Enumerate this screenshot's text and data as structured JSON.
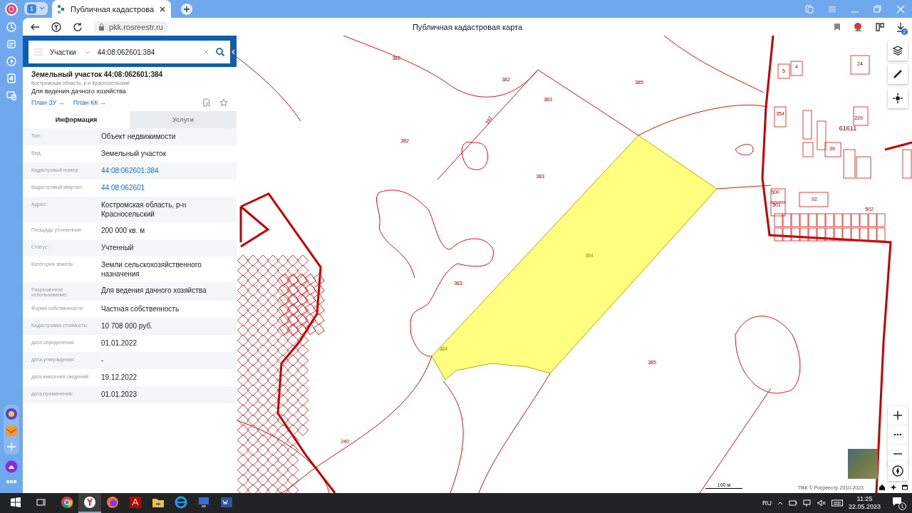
{
  "browser": {
    "profile_initial": "О",
    "tab_count": "1",
    "tabs": [
      {
        "title": "Публичная кадастрова",
        "selected": true
      }
    ],
    "url": "pkk.rosreestr.ru",
    "page_title": "Публичная кадастровая карта",
    "downloads_badge": "2"
  },
  "search": {
    "layer": "Участки",
    "query": "44:08:062601:384"
  },
  "parcel": {
    "title": "Земельный участок 44:08:062601:384",
    "region": "Костромская область, р-н Красносельский",
    "purpose": "Для ведения дачного хозяйства",
    "links": [
      "План ЗУ →",
      "План КК →"
    ]
  },
  "info_tabs": [
    {
      "label": "Информация",
      "selected": true
    },
    {
      "label": "Услуги",
      "selected": false
    }
  ],
  "fields": [
    {
      "label": "Тип:",
      "value": "Объект недвижимости",
      "kind": "text"
    },
    {
      "label": "Вид:",
      "value": "Земельный участок",
      "kind": "text"
    },
    {
      "label": "Кадастровый номер:",
      "value": "44:08:062601:384",
      "kind": "link"
    },
    {
      "label": "Кадастровый квартал:",
      "value": "44:08:062601",
      "kind": "link"
    },
    {
      "label": "Адрес:",
      "value": "Костромская область, р-н Красносельский",
      "kind": "text"
    },
    {
      "label": "Площадь уточненная:",
      "value": "200 000 кв. м",
      "kind": "text"
    },
    {
      "label": "Статус:",
      "value": "Учтенный",
      "kind": "text"
    },
    {
      "label": "Категория земель:",
      "value": "Земли сельскохозяйственного назначения",
      "kind": "text"
    },
    {
      "label": "Разрешенное использование:",
      "value": "Для ведения дачного хозяйства",
      "kind": "text"
    },
    {
      "label": "Форма собственности:",
      "value": "Частная собственность",
      "kind": "text"
    },
    {
      "label": "Кадастровая стоимость:",
      "value": "10 708 000 руб.",
      "kind": "text"
    },
    {
      "label": "дата определения:",
      "value": "01.01.2022",
      "kind": "text"
    },
    {
      "label": "дата утверждения:",
      "value": "-",
      "kind": "text"
    },
    {
      "label": "дата внесения сведений:",
      "value": "19.12.2022",
      "kind": "text"
    },
    {
      "label": "дата применения:",
      "value": "01.01.2023",
      "kind": "text"
    }
  ],
  "map": {
    "labels": [
      {
        "text": "382",
        "selected": false
      },
      {
        "text": "382",
        "selected": false
      },
      {
        "text": "383",
        "selected": false
      },
      {
        "text": "385",
        "selected": false
      },
      {
        "text": "392",
        "selected": false
      },
      {
        "text": "382",
        "selected": false
      },
      {
        "text": "383",
        "selected": false
      },
      {
        "text": "384",
        "selected": true
      },
      {
        "text": "383",
        "selected": false
      },
      {
        "text": "384",
        "selected": true
      },
      {
        "text": "385",
        "selected": false
      },
      {
        "text": "240",
        "selected": false
      },
      {
        "text": "61611",
        "selected": false
      },
      {
        "text": "5",
        "selected": false
      },
      {
        "text": "4",
        "selected": false
      },
      {
        "text": "24",
        "selected": false
      },
      {
        "text": "229",
        "selected": false
      },
      {
        "text": "354",
        "selected": false
      },
      {
        "text": "92",
        "selected": false
      },
      {
        "text": "39",
        "selected": false
      },
      {
        "text": "500",
        "selected": false
      },
      {
        "text": "501",
        "selected": false
      },
      {
        "text": "502",
        "selected": false
      }
    ],
    "scale": "100 м",
    "attribution": "ПКК © Росреестр 2010-2023"
  },
  "taskbar": {
    "apps": [
      {
        "kind": "chrome",
        "selected": false
      },
      {
        "kind": "yandex",
        "selected": true
      },
      {
        "kind": "firefox",
        "selected": false
      },
      {
        "kind": "acrobat",
        "selected": false
      },
      {
        "kind": "explorer",
        "selected": false
      },
      {
        "kind": "ie",
        "selected": false
      },
      {
        "kind": "network",
        "selected": false
      },
      {
        "kind": "word",
        "selected": false
      }
    ],
    "language": "RU",
    "time": "11:25",
    "date": "22.05.2023",
    "notifications": "1"
  }
}
